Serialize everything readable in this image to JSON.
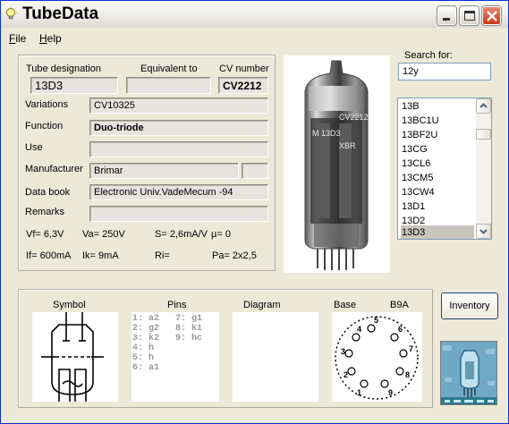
{
  "window": {
    "title": "TubeData"
  },
  "menu": {
    "file": "File",
    "file_hotkey": "F",
    "file_rest": "ile",
    "help": "Help",
    "help_hotkey": "H",
    "help_rest": "elp"
  },
  "labels": {
    "tube_designation": "Tube designation",
    "equivalent_to": "Equivalent to",
    "cv_number": "CV number",
    "variations": "Variations",
    "function": "Function",
    "use": "Use",
    "manufacturer": "Manufacturer",
    "data_book": "Data book",
    "remarks": "Remarks",
    "search_for": "Search for:",
    "symbol": "Symbol",
    "pins": "Pins",
    "diagram": "Diagram",
    "base": "Base",
    "base_type": "B9A"
  },
  "values": {
    "tube_designation": "13D3",
    "equivalent_to": "",
    "cv_number": "CV2212",
    "variations": "CV10325",
    "function": "Duo-triode",
    "use": "",
    "manufacturer": "Brimar",
    "manufacturer_extra": "",
    "data_book": "Electronic Univ.VadeMecum -94",
    "remarks": ""
  },
  "params": {
    "vf": "Vf= 6,3V",
    "va": "Va= 250V",
    "s": "S= 2,6mA/V",
    "mu": "µ=   0",
    "if": "If= 600mA",
    "ik": "Ik=  9mA",
    "ri": "Ri=",
    "pa": "Pa= 2x2,5"
  },
  "search": {
    "value": "12y"
  },
  "list": {
    "items": [
      "13B",
      "13BC1U",
      "13BF2U",
      "13CG",
      "13CL6",
      "13CM5",
      "13CW4",
      "13D1",
      "13D2",
      "13D3"
    ],
    "selected": "13D3"
  },
  "pins": {
    "col1": [
      "1: a2",
      "2: g2",
      "3: k2",
      "4: h",
      "5: h",
      "6: a1"
    ],
    "col2": [
      "7: g1",
      "8: k1",
      "9: hc",
      "",
      "",
      ""
    ]
  },
  "base_pins": [
    "1",
    "2",
    "3",
    "4",
    "5",
    "6",
    "7",
    "8",
    "9"
  ],
  "tube_print": [
    "CV2212",
    "M 13D3",
    "XBR"
  ],
  "buttons": {
    "inventory": "Inventory"
  },
  "colors": {
    "title_bar_border": "#0831d9",
    "close_button": "#c8381d",
    "list_selection": "#c8c5bb",
    "window_bg": "#ece9d8"
  }
}
